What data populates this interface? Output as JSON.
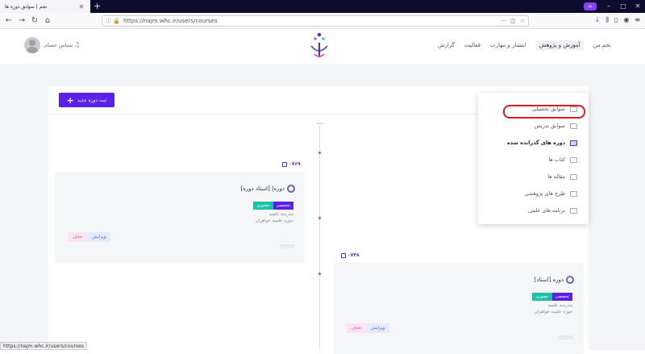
{
  "browser": {
    "tab_title": "نجم | سوابق دوره ها",
    "url": "https://najm.whc.ir/users/courses",
    "status_url": "https://najm.whc.ir/users/courses"
  },
  "header": {
    "menu": [
      "نجم من",
      "آموزش و پژوهش",
      "انتشار و مهارت",
      "فعالیت",
      "گزارش"
    ],
    "active_menu_index": 1,
    "user_name": "ستاس حسام"
  },
  "content": {
    "add_button_label": "ثبت دوره جدید"
  },
  "courses": [
    {
      "code": "۰۷۶۹",
      "title": "دوره| [استاد دوره]",
      "tags": [
        "تخصصی",
        "حضوری"
      ],
      "meta_line1": "مدرسه علمیه",
      "meta_line2": "حوزه علمیه خواهران",
      "edit_label": "ویرایش",
      "delete_label": "حذف",
      "stars": "♡♡♡♡"
    },
    {
      "code": "۰۷۴۸",
      "title": "دوره [استاد]",
      "tags": [
        "تخصصی",
        "حضوری"
      ],
      "meta_line1": "مدرسه علمیه",
      "meta_line2": "حوزه علمیه خواهران",
      "edit_label": "ویرایش",
      "delete_label": "حذف",
      "stars": "♡♡♡♡"
    }
  ],
  "dropdown": {
    "items": [
      "سوابق تحصیلی",
      "سوابق تدریس",
      "دوره های گذرانده شده",
      "کتاب ها",
      "مقاله ها",
      "طرح های پژوهشی",
      "برنامه های علمی"
    ],
    "active_index": 2
  },
  "colors": {
    "primary": "#5b21e6",
    "accent_teal": "#1cc2a6",
    "accent_pink": "#e040a0",
    "highlight_red": "#e41b1b"
  }
}
